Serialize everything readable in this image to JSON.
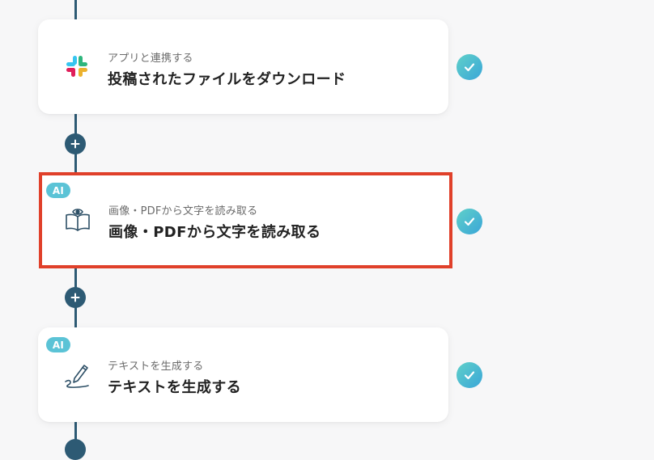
{
  "flow": {
    "steps": [
      {
        "subtitle": "アプリと連携する",
        "title": "投稿されたファイルをダウンロード",
        "icon": "slack-icon",
        "status": "completed"
      },
      {
        "badge": "AI",
        "subtitle": "画像・PDFから文字を読み取る",
        "title": "画像・PDFから文字を読み取る",
        "icon": "book-eye-icon",
        "status": "completed",
        "selected": true
      },
      {
        "badge": "AI",
        "subtitle": "テキストを生成する",
        "title": "テキストを生成する",
        "icon": "pencil-write-icon",
        "status": "completed"
      }
    ]
  },
  "colors": {
    "line": "#2d5a74",
    "selected_border": "#e0402a",
    "ai_badge": "#5bc3d6",
    "check_gradient_start": "#5fd0c9",
    "check_gradient_end": "#3aa6d8",
    "background": "#f7f7f8"
  }
}
